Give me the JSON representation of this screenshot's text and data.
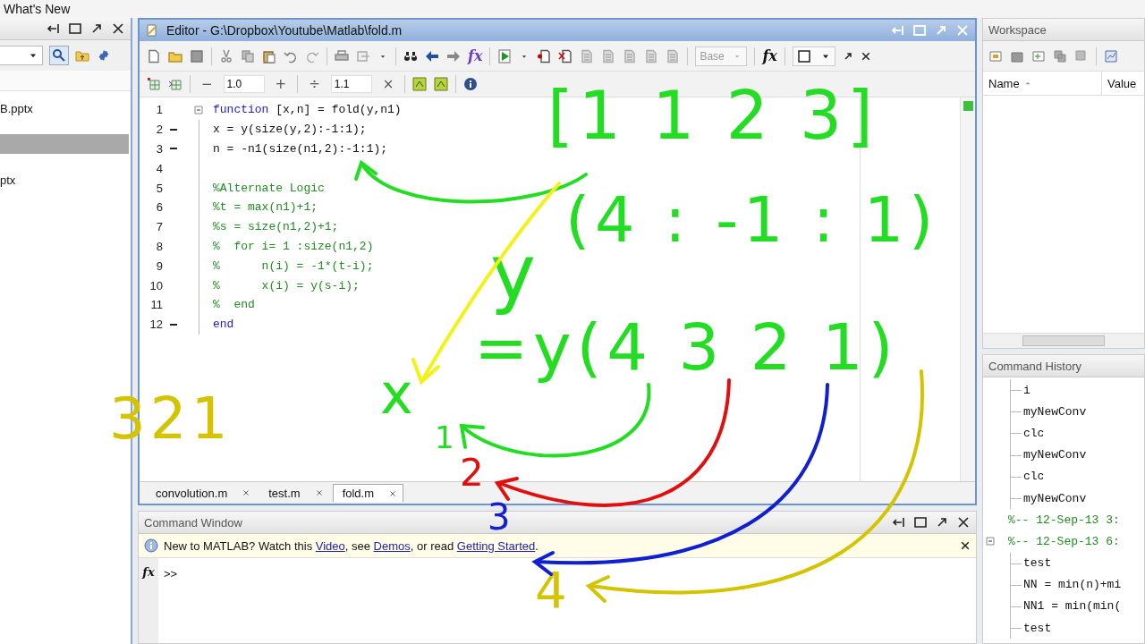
{
  "top_strip": {
    "title": "What's New"
  },
  "file_browser": {
    "files": [
      {
        "name": "B.pptx",
        "selected": false
      },
      {
        "selected": true
      },
      {
        "name": "ptx",
        "selected": false
      }
    ]
  },
  "editor": {
    "title": "Editor - G:\\Dropbox\\Youtube\\Matlab\\fold.m",
    "fx_labels": [
      "fx",
      "fx"
    ],
    "base": "Base",
    "cell_toolbar": {
      "decrement": "−",
      "value_1": "1.0",
      "increment": "+",
      "divide": "÷",
      "value_2": "1.1",
      "multiply": "×"
    },
    "lines": [
      {
        "number": "1",
        "executable": false,
        "collapsible": true,
        "segments": [
          {
            "t": "function",
            "kind": "keyword"
          },
          {
            "t": " [x,n] = fold(y,n1)",
            "kind": "plain"
          }
        ]
      },
      {
        "number": "2",
        "executable": true,
        "collapsible": false,
        "segments": [
          {
            "t": "x = y(size(y,2):-1:1);",
            "kind": "plain"
          }
        ]
      },
      {
        "number": "3",
        "executable": true,
        "collapsible": false,
        "segments": [
          {
            "t": "n = -n1(size(n1,2):-1:1);",
            "kind": "plain"
          }
        ]
      },
      {
        "number": "4",
        "executable": false,
        "collapsible": false
      },
      {
        "number": "5",
        "executable": false,
        "collapsible": false,
        "segments": [
          {
            "t": "%Alternate Logic",
            "kind": "comment"
          }
        ]
      },
      {
        "number": "6",
        "executable": false,
        "collapsible": false,
        "segments": [
          {
            "t": "%t = max(n1)+1;",
            "kind": "comment"
          }
        ]
      },
      {
        "number": "7",
        "executable": false,
        "collapsible": false,
        "segments": [
          {
            "t": "%s = size(n1,2)+1;",
            "kind": "comment"
          }
        ]
      },
      {
        "number": "8",
        "executable": false,
        "collapsible": false,
        "segments": [
          {
            "t": "%  for i= 1 :size(n1,2)",
            "kind": "comment"
          }
        ]
      },
      {
        "number": "9",
        "executable": false,
        "collapsible": false,
        "segments": [
          {
            "t": "%      n(i) = -1*(t-i);",
            "kind": "comment"
          }
        ]
      },
      {
        "number": "10",
        "executable": false,
        "collapsible": false,
        "segments": [
          {
            "t": "%      x(i) = y(s-i);",
            "kind": "comment"
          }
        ]
      },
      {
        "number": "11",
        "executable": false,
        "collapsible": false,
        "segments": [
          {
            "t": "%  end",
            "kind": "comment"
          }
        ]
      },
      {
        "number": "12",
        "executable": true,
        "collapsible": false,
        "segments": [
          {
            "t": "end",
            "kind": "keyword"
          }
        ]
      }
    ],
    "tabs": [
      {
        "label": "convolution.m",
        "selected": false
      },
      {
        "label": "test.m",
        "selected": false
      },
      {
        "label": "fold.m",
        "selected": true
      }
    ]
  },
  "command_window": {
    "title": "Command Window",
    "notice": {
      "parts": [
        {
          "t": "New to MATLAB? Watch this ",
          "kind": "text"
        },
        {
          "t": "Video",
          "kind": "link"
        },
        {
          "t": ", see ",
          "kind": "text"
        },
        {
          "t": "Demos",
          "kind": "link"
        },
        {
          "t": ", or read ",
          "kind": "text"
        },
        {
          "t": "Getting Started",
          "kind": "link"
        },
        {
          "t": ".",
          "kind": "text"
        }
      ]
    },
    "fx_label": "fx",
    "prompt": ">>"
  },
  "workspace": {
    "title": "Workspace",
    "columns": [
      {
        "label": "Name",
        "sorted": true
      },
      {
        "label": "Value",
        "sorted": false
      }
    ]
  },
  "command_history": {
    "title": "Command History",
    "entries": [
      {
        "kind": "command",
        "text": "i"
      },
      {
        "kind": "command",
        "text": "myNewConv"
      },
      {
        "kind": "command",
        "text": "clc"
      },
      {
        "kind": "command",
        "text": "myNewConv"
      },
      {
        "kind": "command",
        "text": "clc"
      },
      {
        "kind": "command",
        "text": "myNewConv"
      },
      {
        "kind": "session",
        "text": "%-- 12-Sep-13 3:",
        "expanded": false
      },
      {
        "kind": "session",
        "text": "%-- 12-Sep-13 6:",
        "expanded": true,
        "children": [
          {
            "kind": "command",
            "text": "test"
          },
          {
            "kind": "command",
            "text": "NN = min(n)+mi"
          },
          {
            "kind": "command",
            "text": "NN1 = min(min("
          },
          {
            "kind": "command",
            "text": "test"
          }
        ]
      }
    ]
  },
  "annotations": [
    {
      "text": "[1 1 2 3]",
      "color": "#22dd22"
    },
    {
      "text": "y",
      "color": "#22dd22"
    },
    {
      "text": "(4 : -1 : 1)",
      "color": "#22dd22"
    },
    {
      "text": "x",
      "color": "#22dd22"
    },
    {
      "text": "=y(4 3 2 1)",
      "color": "#22dd22"
    },
    {
      "text": "1",
      "color": "#22dd22"
    },
    {
      "text": "321",
      "color": "#d4c400"
    },
    {
      "text": "2",
      "color": "#e01010"
    },
    {
      "text": "3",
      "color": "#1020d0"
    },
    {
      "text": "4",
      "color": "#d4c400"
    }
  ]
}
